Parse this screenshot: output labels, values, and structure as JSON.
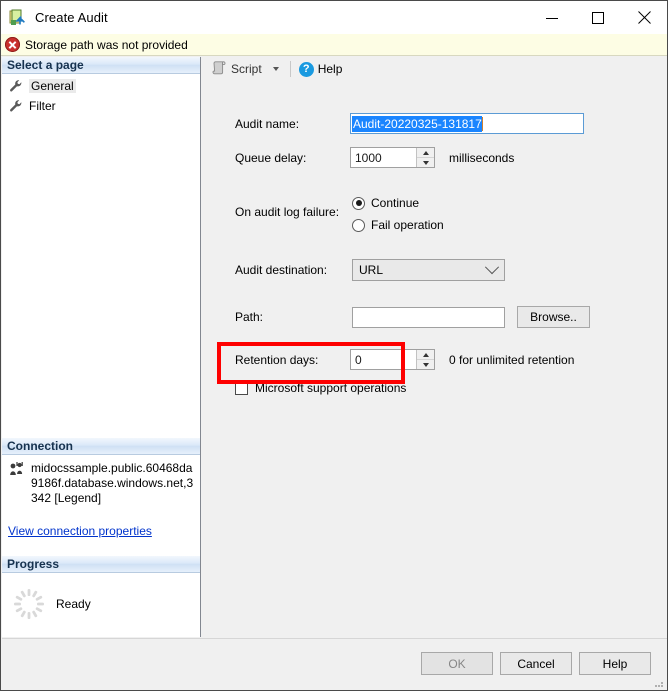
{
  "window": {
    "title": "Create Audit",
    "icon": "create-audit-icon",
    "controls": {
      "minimize": "minimize-icon",
      "maximize": "maximize-icon",
      "close": "close-icon"
    }
  },
  "error_bar": {
    "icon": "error-icon",
    "message": "Storage path was not provided"
  },
  "sidebar": {
    "select_page": {
      "header": "Select a page",
      "items": [
        {
          "label": "General",
          "icon": "wrench-icon",
          "selected": true
        },
        {
          "label": "Filter",
          "icon": "wrench-icon",
          "selected": false
        }
      ]
    },
    "connection": {
      "header": "Connection",
      "icon": "connection-icon",
      "server": "midocssample.public.60468da9186f.database.windows.net,3342 [Legend]",
      "link": "View connection properties"
    },
    "progress": {
      "header": "Progress",
      "icon": "progress-spinner-icon",
      "status": "Ready"
    }
  },
  "toolbar": {
    "script_label": "Script",
    "script_icon": "script-icon",
    "dropdown_icon": "chevron-down-icon",
    "help_label": "Help",
    "help_icon": "help-question-icon"
  },
  "form": {
    "audit_name": {
      "label": "Audit name:",
      "value": "Audit-20220325-131817",
      "selected": true
    },
    "queue_delay": {
      "label": "Queue delay:",
      "value": "1000",
      "unit": "milliseconds"
    },
    "on_audit_log_failure": {
      "label": "On audit log failure:",
      "options": [
        {
          "label": "Continue",
          "checked": true
        },
        {
          "label": "Fail operation",
          "checked": false
        }
      ]
    },
    "audit_destination": {
      "label": "Audit destination:",
      "value": "URL"
    },
    "path": {
      "label": "Path:",
      "value": "",
      "browse_label": "Browse.."
    },
    "retention_days": {
      "label": "Retention days:",
      "value": "0",
      "hint": "0 for unlimited retention"
    },
    "ms_support_operations": {
      "label": "Microsoft support operations",
      "checked": false
    }
  },
  "footer": {
    "ok_label": "OK",
    "cancel_label": "Cancel",
    "help_label": "Help"
  },
  "colors": {
    "annotation": "#fe0000",
    "selection": "#1a85ff",
    "error_bg": "#fdfde4",
    "link": "#0033cc"
  }
}
